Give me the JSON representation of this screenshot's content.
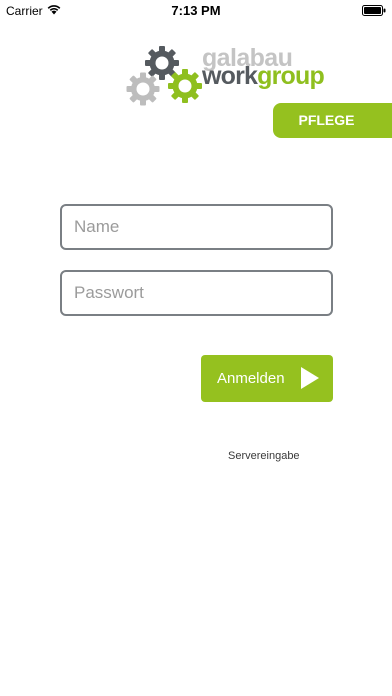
{
  "status_bar": {
    "carrier": "Carrier",
    "time": "7:13 PM",
    "icons": [
      "wifi-icon",
      "battery-icon"
    ]
  },
  "logo": {
    "line1": "galabau",
    "line2_part1": "work",
    "line2_part2": "group",
    "icon": "gears-logo-icon",
    "colors": {
      "dark": "#555a5f",
      "light_gray": "#c4c4c4",
      "green": "#8fbf1f"
    }
  },
  "badge": {
    "label": "PFLEGE",
    "color": "#95c11f"
  },
  "form": {
    "name": {
      "placeholder": "Name",
      "value": ""
    },
    "password": {
      "placeholder": "Passwort",
      "value": ""
    }
  },
  "login_button": {
    "label": "Anmelden",
    "icon": "play-arrow-icon",
    "color": "#95c11f"
  },
  "server_link": {
    "label": "Servereingabe"
  }
}
